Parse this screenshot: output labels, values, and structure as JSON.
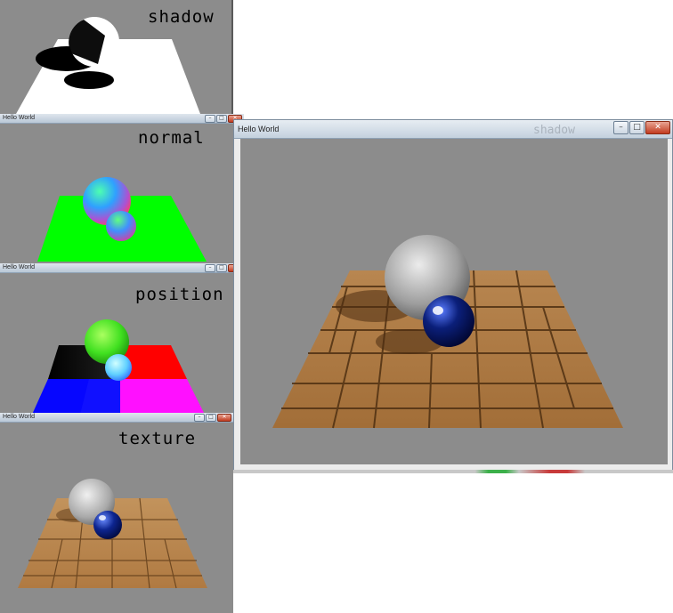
{
  "windows": {
    "shadow": {
      "label": "shadow"
    },
    "normal": {
      "title": "Hello World",
      "label": "normal"
    },
    "position": {
      "title": "Hello World",
      "label": "position"
    },
    "texture": {
      "title": "Hello World",
      "label": "texture"
    },
    "main": {
      "title": "Hello World",
      "ghost_label": "shadow"
    }
  },
  "controls": {
    "minimize": "–",
    "maximize": "□",
    "close": "✕"
  },
  "colors": {
    "background": "#8c8c8c",
    "floor_wood": "#a9773f",
    "sphere_stone": "#b5b5b5",
    "sphere_globe": "#0b1f7a"
  }
}
